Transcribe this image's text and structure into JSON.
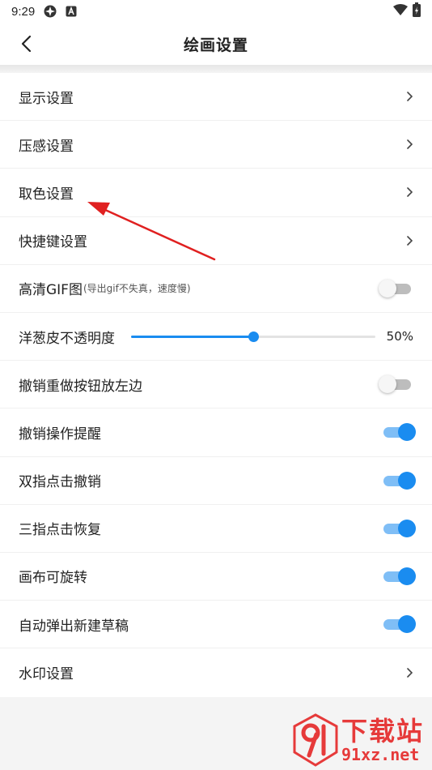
{
  "status_bar": {
    "time": "9:29"
  },
  "app_bar": {
    "title": "绘画设置"
  },
  "settings": {
    "display": "显示设置",
    "pressure": "压感设置",
    "color_pick": "取色设置",
    "shortcuts": "快捷键设置",
    "hd_gif": {
      "label": "高清GIF图",
      "note": "(导出gif不失真，速度慢)",
      "on": false
    },
    "onion": {
      "label": "洋葱皮不透明度",
      "value_text": "50%",
      "value": 0.5
    },
    "undo_left": {
      "label": "撤销重做按钮放左边",
      "on": false
    },
    "undo_tip": {
      "label": "撤销操作提醒",
      "on": true
    },
    "two_finger": {
      "label": "双指点击撤销",
      "on": true
    },
    "three_finger": {
      "label": "三指点击恢复",
      "on": true
    },
    "canvas_rotate": {
      "label": "画布可旋转",
      "on": true
    },
    "auto_draft": {
      "label": "自动弹出新建草稿",
      "on": true
    },
    "watermark": "水印设置"
  },
  "watermark_logo": {
    "main": "下载站",
    "sub": "91xz.net"
  },
  "colors": {
    "accent": "#1a8cf0",
    "arrow": "#e02020",
    "watermark": "#e63a3a"
  }
}
